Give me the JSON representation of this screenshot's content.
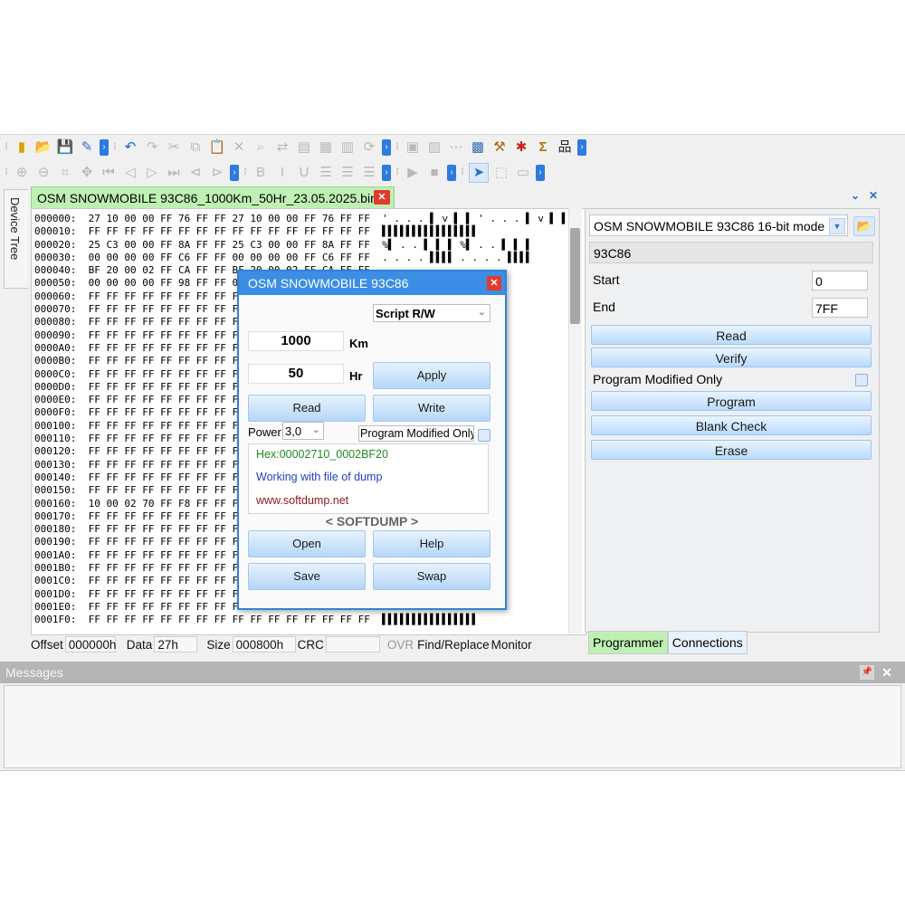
{
  "toolbar": {
    "row1_icons": [
      "chip-icon",
      "open-folder-icon",
      "save-icon",
      "edit-icon",
      "undo-icon",
      "redo-icon",
      "cut-icon",
      "copy-icon",
      "paste-icon",
      "delete-icon",
      "find-icon",
      "replace-icon",
      "document-icon",
      "hex-icon",
      "compare-icon",
      "refresh-icon",
      "copy-block-icon",
      "paste-block-icon",
      "fill-icon",
      "calculator-icon",
      "plugin-icon",
      "bug-icon",
      "sum-icon",
      "network-icon"
    ],
    "row2_icons": [
      "zoom-in-icon",
      "zoom-out-icon",
      "fit-icon",
      "move-icon",
      "first-icon",
      "prev-icon",
      "next-icon",
      "last-icon",
      "back-icon",
      "forward-icon",
      "bold-icon",
      "italic-icon",
      "underline-icon",
      "align-left-icon",
      "align-center-icon",
      "align-right-icon",
      "play-icon",
      "stop-icon",
      "cursor-icon",
      "select-icon",
      "screen-icon"
    ]
  },
  "sidebar": {
    "device_tree_label": "Device Tree"
  },
  "document_tab": {
    "title": "OSM SNOWMOBILE 93C86_1000Km_50Hr_23.05.2025.bin"
  },
  "hex": {
    "lines": [
      "000000:  27 10 00 00 FF 76 FF FF 27 10 00 00 FF 76 FF FF  ' . . . ▌ v ▌ ▌ ' . . . ▌ v ▌ ▌",
      "000010:  FF FF FF FF FF FF FF FF FF FF FF FF FF FF FF FF  ▌▌▌▌▌▌▌▌▌▌▌▌▌▌▌▌",
      "000020:  25 C3 00 00 FF 8A FF FF 25 C3 00 00 FF 8A FF FF  %▌ . . ▌ ▌ ▌ %▌ . . ▌ ▌ ▌",
      "000030:  00 00 00 00 FF C6 FF FF 00 00 00 00 FF C6 FF FF  . . . . ▌▌▌▌ . . . . ▌▌▌▌",
      "000040:  BF 20 00 02 FF CA FF FF BF 20 00 02 FF CA FF FF",
      "000050:  00 00 00 00 FF 98 FF FF 00 00",
      "000060:  FF FF FF FF FF FF FF FF FF FF",
      "000070:  FF FF FF FF FF FF FF FF FF FF",
      "000080:  FF FF FF FF FF FF FF FF FF FF",
      "000090:  FF FF FF FF FF FF FF FF FF FF",
      "0000A0:  FF FF FF FF FF FF FF FF FF FF",
      "0000B0:  FF FF FF FF FF FF FF FF FF FF",
      "0000C0:  FF FF FF FF FF FF FF FF FF FF",
      "0000D0:  FF FF FF FF FF FF FF FF FF FF",
      "0000E0:  FF FF FF FF FF FF FF FF FF FF",
      "0000F0:  FF FF FF FF FF FF FF FF FF FF",
      "000100:  FF FF FF FF FF FF FF FF FF FF",
      "000110:  FF FF FF FF FF FF FF FF FF FF",
      "000120:  FF FF FF FF FF FF FF FF FF FF",
      "000130:  FF FF FF FF FF FF FF FF FF FF",
      "000140:  FF FF FF FF FF FF FF FF FF FF",
      "000150:  FF FF FF FF FF FF FF FF FF FF",
      "000160:  10 00 02 70 FF F8 FF FF FF FF",
      "000170:  FF FF FF FF FF FF FF FF FF FF",
      "000180:  FF FF FF FF FF FF FF FF FF FF",
      "000190:  FF FF FF FF FF FF FF FF FF FF",
      "0001A0:  FF FF FF FF FF FF FF FF FF FF",
      "0001B0:  FF FF FF FF FF FF FF FF FF FF",
      "0001C0:  FF FF FF FF FF FF FF FF FF FF",
      "0001D0:  FF FF FF FF FF FF FF FF FF FF",
      "0001E0:  FF FF FF FF FF FF FF FF FF FF",
      "0001F0:  FF FF FF FF FF FF FF FF FF FF FF FF FF FF FF FF  ▌▌▌▌▌▌▌▌▌▌▌▌▌▌▌▌"
    ]
  },
  "status": {
    "offset_label": "Offset",
    "offset_value": "000000h",
    "data_label": "Data",
    "data_value": "27h",
    "size_label": "Size",
    "size_value": "000800h",
    "crc_label": "CRC",
    "crc_value": "",
    "ovr": "OVR",
    "find_replace": "Find/Replace",
    "monitor": "Monitor"
  },
  "programmer": {
    "device_combo": "OSM SNOWMOBILE 93C86 16-bit mode",
    "chip": "93C86",
    "start_label": "Start",
    "start_value": "0",
    "end_label": "End",
    "end_value": "7FF",
    "read": "Read",
    "verify": "Verify",
    "program_modified_only": "Program Modified Only",
    "program": "Program",
    "blank_check": "Blank Check",
    "erase": "Erase"
  },
  "bottom_tabs": {
    "programmer": "Programmer",
    "connections": "Connections"
  },
  "messages": {
    "title": "Messages"
  },
  "dialog": {
    "title": "OSM SNOWMOBILE 93C86",
    "script_select": "Script R/W",
    "km_value": "1000",
    "km_unit": "Km",
    "hr_value": "50",
    "hr_unit": "Hr",
    "apply": "Apply",
    "read": "Read",
    "write": "Write",
    "power_label": "Power",
    "power_value": "3,0",
    "program_modified_only": "Program Modified Only",
    "info_hex": "Hex:00002710_0002BF20",
    "info_status": "Working with file of dump",
    "info_url": "www.softdump.net",
    "brand": "< SOFTDUMP >",
    "open": "Open",
    "help": "Help",
    "save": "Save",
    "swap": "Swap"
  }
}
